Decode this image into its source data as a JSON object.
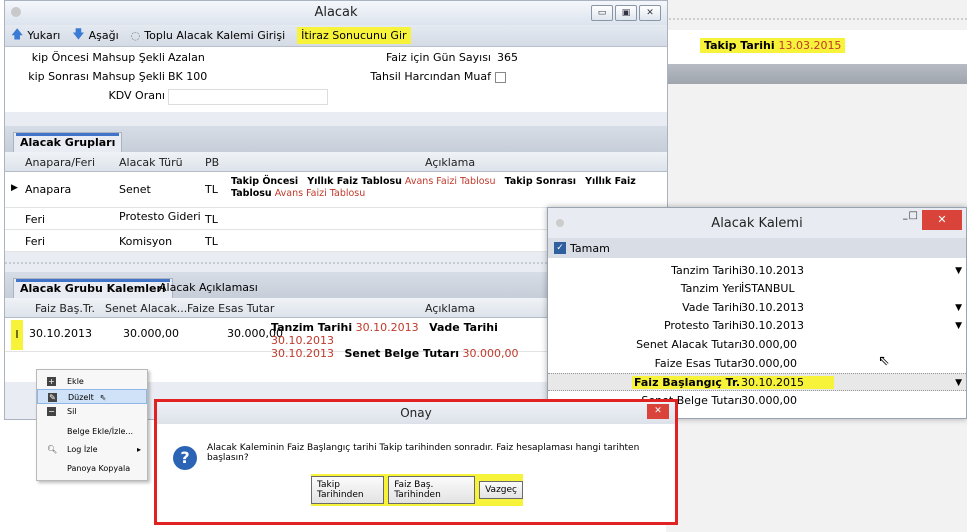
{
  "background": {
    "takip_label": "Takip Tarihi",
    "takip_value": "13.03.2015"
  },
  "main": {
    "title": "Alacak",
    "window_buttons": [
      "▭",
      "▣",
      "✕"
    ],
    "toolbar": {
      "yukari": "Yukarı",
      "asagi": "Aşağı",
      "toplu": "Toplu Alacak Kalemi Girişi",
      "itiraz": "İtiraz Sonucunu Gir"
    },
    "form": {
      "l1": "kip Öncesi Mahsup Şekli",
      "v1": "Azalan",
      "l2": "kip Sonrası Mahsup Şekli",
      "v2": "BK 100",
      "l3": "KDV Oranı",
      "v3": "",
      "r1": "Faiz için Gün Sayısı",
      "rv1": "365",
      "r2": "Tahsil Harcından Muaf"
    },
    "tab1": "Alacak Grupları",
    "grid1_headers": [
      "Anapara/Feri",
      "Alacak Türü",
      "PB",
      "Açıklama"
    ],
    "grid1_rows": [
      {
        "a": "Anapara",
        "b": "Senet",
        "c": "TL",
        "d1": "Takip Öncesi",
        "d2": "Yıllık Faiz Tablosu",
        "d3": "Avans Faizi Tablosu",
        "d4": "Takip Sonrası",
        "d5": "Yıllık Faiz Tablosu",
        "d6": "Avans Faizi Tablosu"
      },
      {
        "a": "Feri",
        "b": "Protesto Gideri",
        "c": "TL"
      },
      {
        "a": "Feri",
        "b": "Komisyon",
        "c": "TL"
      }
    ],
    "tab2": "Alacak Grubu Kalemleri",
    "tab3": "Alacak Açıklaması",
    "grid2_headers": [
      "Faiz Baş.Tr.",
      "Senet Alacak...",
      "Faize Esas Tutar",
      "Açıklama"
    ],
    "grid2_row": {
      "indicator": "I",
      "date": "30.10.2013",
      "senet": "30.000,00",
      "faize": "30.000,00",
      "t1": "Tanzim Tarihi",
      "t1v": "30.10.2013",
      "t2": "Vade Tarihi",
      "t2v": "30.10.2013",
      "t3v": "30.10.2013",
      "t4": "Senet Belge Tutarı",
      "t4v": "30.000,00"
    }
  },
  "context_menu": [
    "Ekle",
    "Düzelt",
    "Sil",
    "Belge Ekle/İzle...",
    "Log İzle",
    "Panoya Kopyala"
  ],
  "kalem": {
    "title": "Alacak Kalemi",
    "tamam": "Tamam",
    "rows": [
      {
        "label": "Tanzim Tarihi",
        "value": "30.10.2013"
      },
      {
        "label": "Tanzim Yeri",
        "value": "İSTANBUL"
      },
      {
        "label": "Vade Tarihi",
        "value": "30.10.2013"
      },
      {
        "label": "Protesto Tarihi",
        "value": "30.10.2013"
      },
      {
        "label": "Senet Alacak Tutarı",
        "value": "30.000,00"
      },
      {
        "label": "Faize Esas Tutar",
        "value": "30.000,00"
      },
      {
        "label": "Faiz Başlangıç Tr.",
        "value": "30.10.2015"
      },
      {
        "label": "Senet Belge Tutarı",
        "value": "30.000,00"
      }
    ]
  },
  "onay": {
    "title": "Onay",
    "message": "Alacak Kaleminin Faiz Başlangıç tarihi Takip tarihinden sonradır. Faiz hesaplaması hangi tarihten başlasın?",
    "buttons": [
      "Takip Tarihinden",
      "Faiz Baş. Tarihinden",
      "Vazgeç"
    ]
  }
}
